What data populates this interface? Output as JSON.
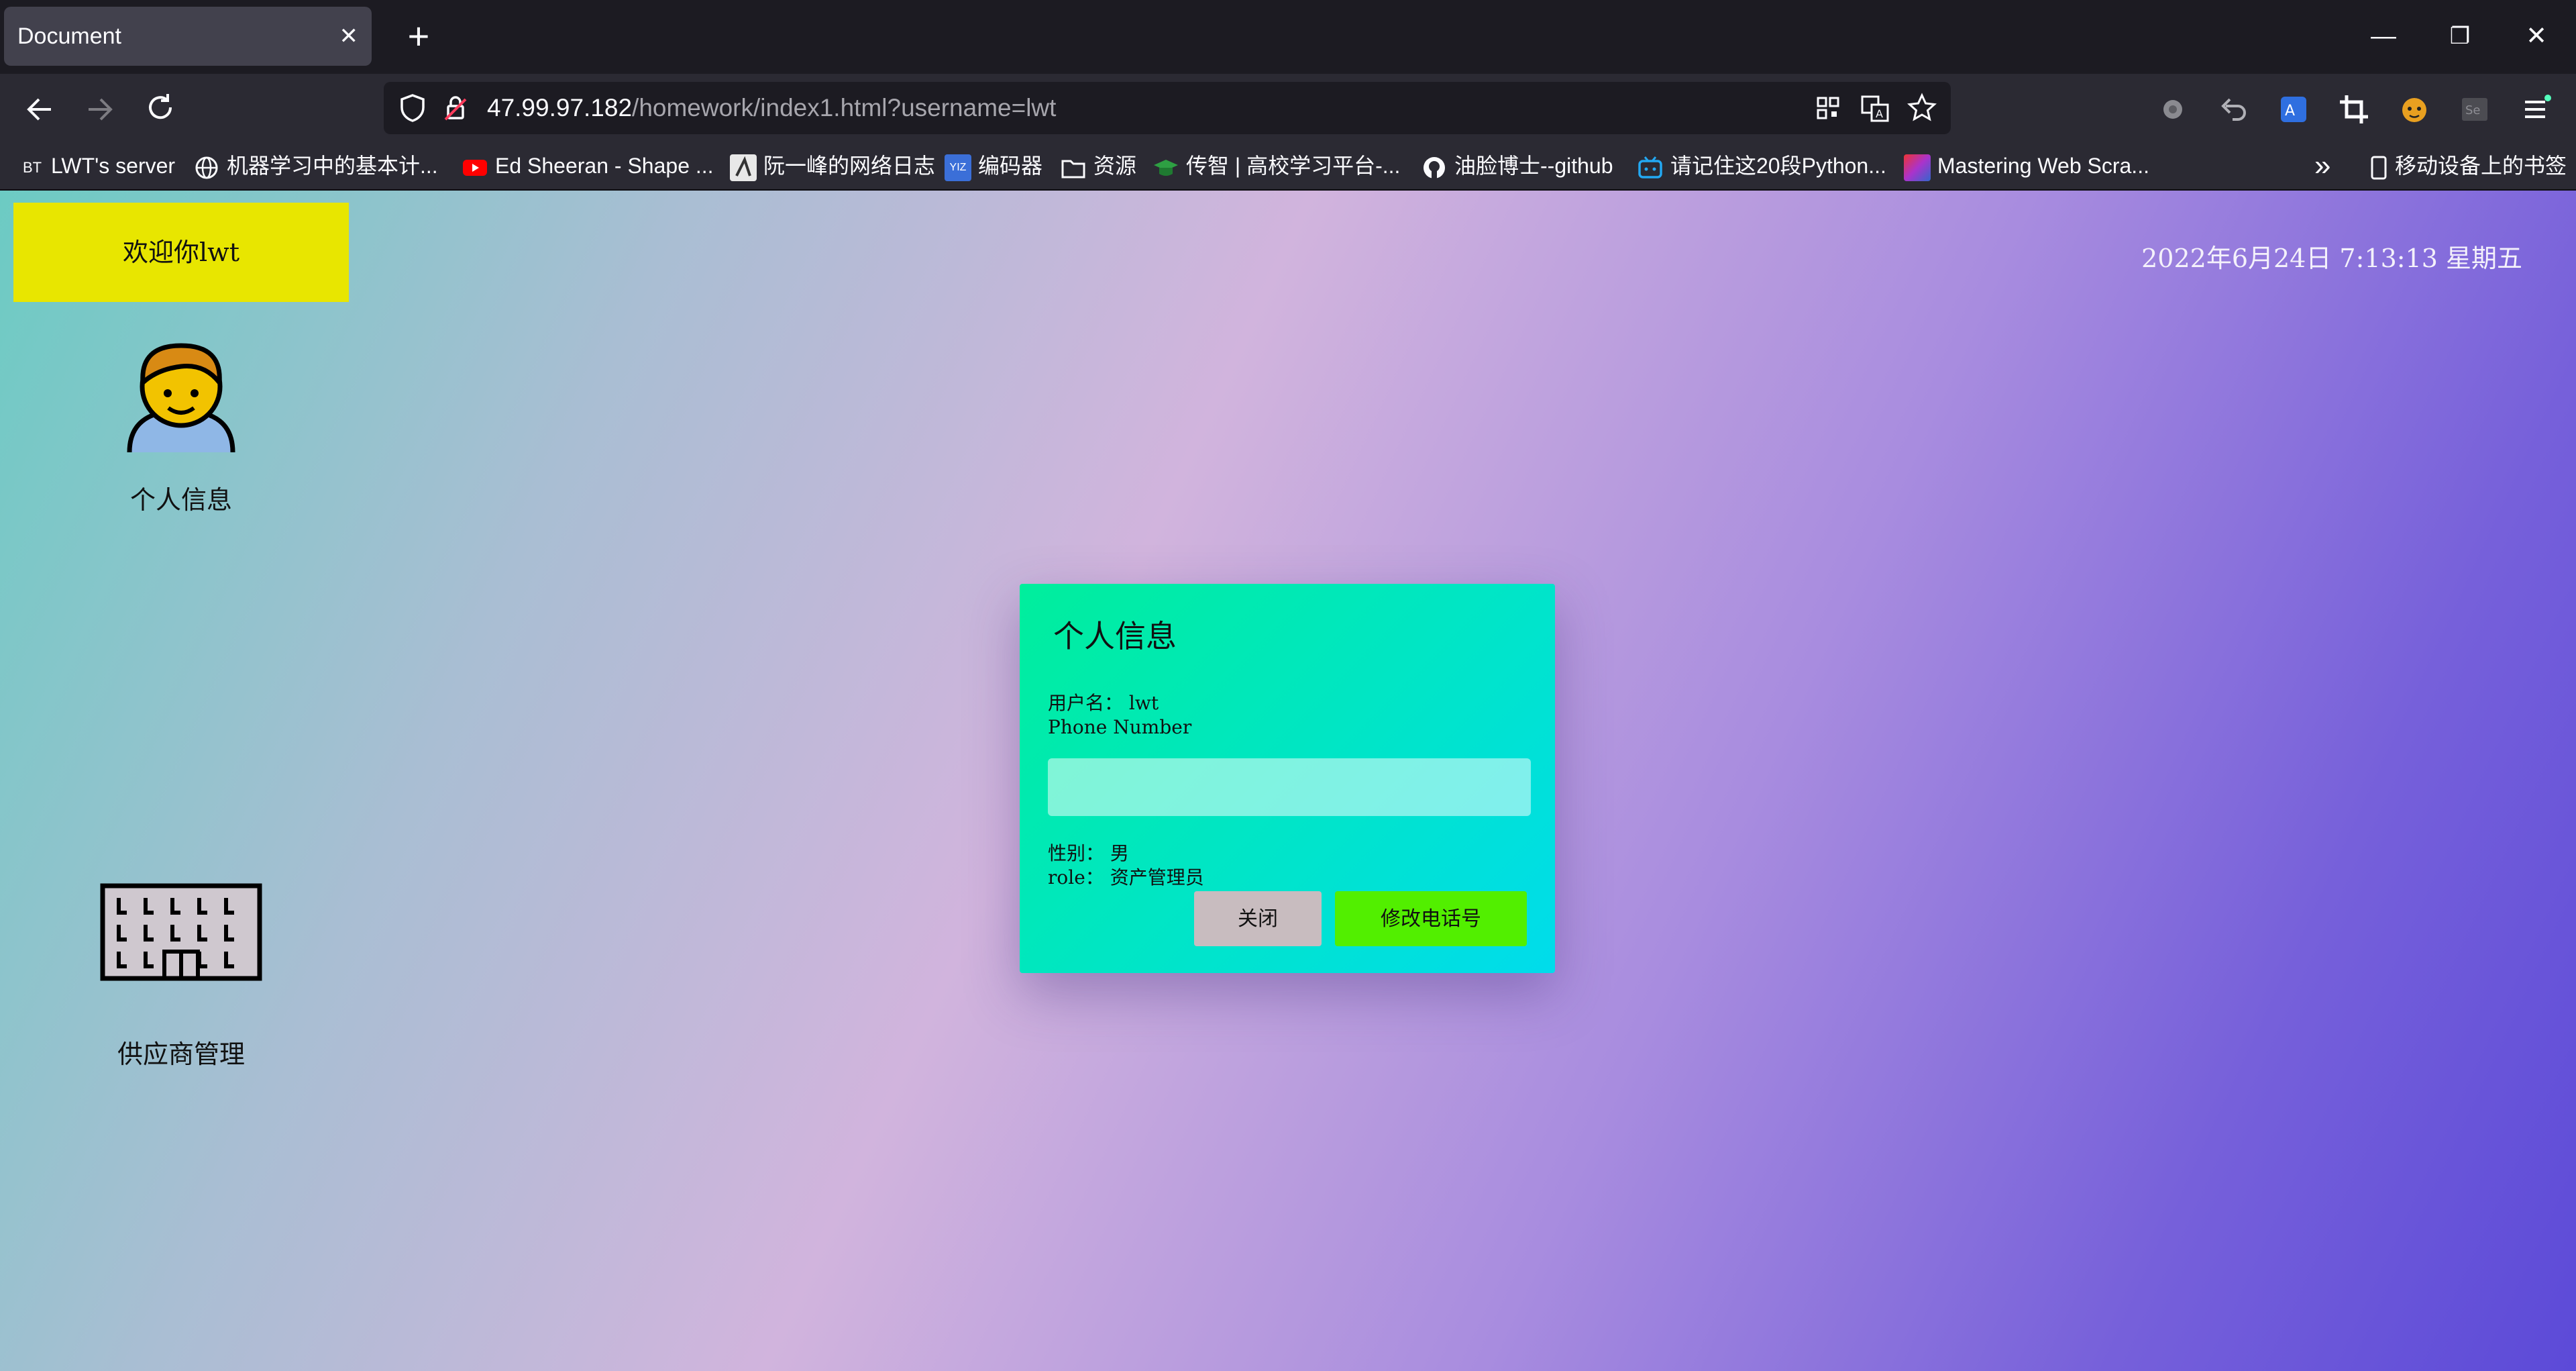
{
  "browser": {
    "tab_title": "Document",
    "tab_close": "✕",
    "new_tab": "+",
    "window_controls": [
      "—",
      "❐",
      "✕"
    ],
    "url_host": "47.99.97.182",
    "url_path": "/homework/index1.html?username=lwt",
    "bookmarks": [
      {
        "icon": "BT",
        "label": "LWT's server"
      },
      {
        "icon": "globe-icon",
        "label": "机器学习中的基本计..."
      },
      {
        "icon": "youtube-icon",
        "label": "Ed Sheeran - Shape ..."
      },
      {
        "icon": "blog-icon",
        "label": "阮一峰的网络日志"
      },
      {
        "icon": "encoder-icon",
        "label": "编码器"
      },
      {
        "icon": "folder-icon",
        "label": "资源"
      },
      {
        "icon": "graduation-cap-icon",
        "label": "传智 | 高校学习平台-..."
      },
      {
        "icon": "github-icon",
        "label": "油脸博士--github"
      },
      {
        "icon": "bilibili-icon",
        "label": "请记住这20段Python..."
      },
      {
        "icon": "book-icon",
        "label": "Mastering Web Scra..."
      }
    ],
    "bookmarks_more": "»",
    "mobile_bookmarks": "移动设备上的书签"
  },
  "page": {
    "welcome": "欢迎你lwt",
    "datetime": "2022年6月24日 7:13:13 星期五",
    "side_items": [
      {
        "icon": "person-icon",
        "label": "个人信息"
      },
      {
        "icon": "office-building-icon",
        "label": "供应商管理"
      }
    ]
  },
  "dialog": {
    "title": "个人信息",
    "username_label": "用户名：",
    "username_value": "lwt",
    "phone_label": "Phone Number",
    "phone_value": "",
    "gender_label": "性别：",
    "gender_value": "男",
    "role_label": "role：",
    "role_value": "资产管理员",
    "close_button": "关闭",
    "edit_phone_button": "修改电话号"
  }
}
